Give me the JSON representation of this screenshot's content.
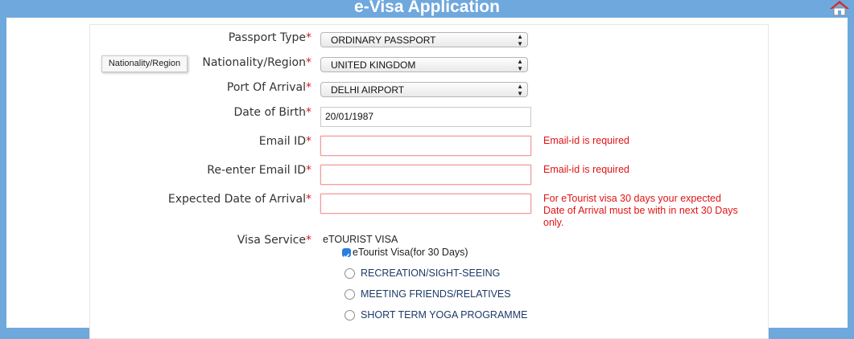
{
  "header": {
    "title": "e-Visa Application",
    "home_icon": "home-icon"
  },
  "tooltip": "Nationality/Region",
  "form": {
    "passport_type": {
      "label": "Passport Type",
      "value": "ORDINARY PASSPORT"
    },
    "nationality": {
      "label": "Nationality/Region",
      "value": "UNITED KINGDOM"
    },
    "port_of_arrival": {
      "label": "Port Of Arrival",
      "value": "DELHI AIRPORT"
    },
    "dob": {
      "label": "Date of Birth",
      "value": "20/01/1987"
    },
    "email": {
      "label": "Email ID",
      "value": "",
      "error": "Email-id is required"
    },
    "email_confirm": {
      "label": "Re-enter Email ID",
      "value": "",
      "error": "Email-id is required"
    },
    "arrival_date": {
      "label": "Expected Date of Arrival",
      "value": "",
      "error": "For eTourist visa 30 days your expected Date of Arrival must be with in next 30 Days only."
    },
    "visa_service": {
      "label": "Visa Service",
      "group": "eTOURIST VISA",
      "checked_option": "eTourist Visa(for 30 Days)",
      "options": [
        "RECREATION/SIGHT-SEEING",
        "MEETING FRIENDS/RELATIVES",
        "SHORT TERM YOGA PROGRAMME"
      ]
    }
  },
  "required_marker": "*",
  "colors": {
    "header": "#6fa8dc",
    "error": "#e01414",
    "required": "#d31a1a"
  }
}
